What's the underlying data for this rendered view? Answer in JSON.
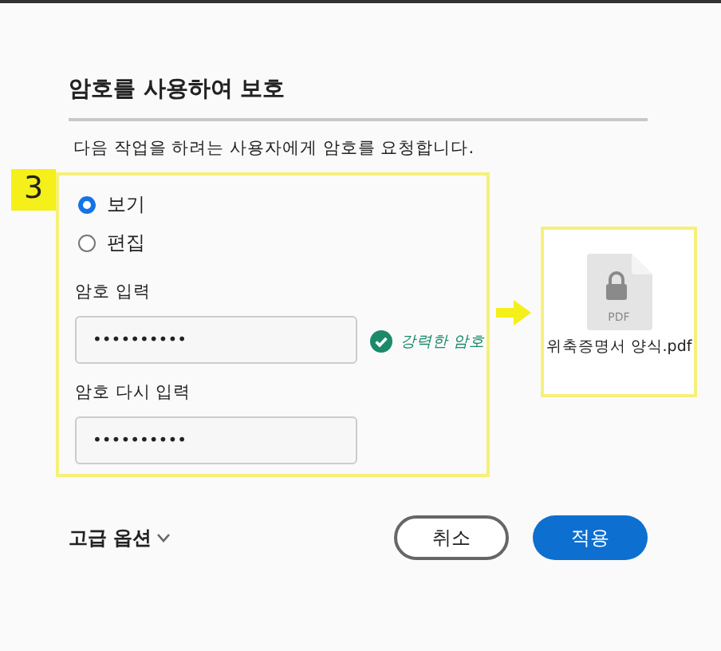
{
  "dialog": {
    "title": "암호를 사용하여 보호",
    "description": "다음 작업을 하려는 사용자에게 암호를 요청합니다."
  },
  "step_badge": "3",
  "permissions": [
    {
      "label": "보기",
      "selected": true
    },
    {
      "label": "편집",
      "selected": false
    }
  ],
  "password": {
    "label": "암호 입력",
    "value": "••••••••••"
  },
  "strength": {
    "text": "강력한 암호",
    "ok": true
  },
  "confirm": {
    "label": "암호 다시 입력",
    "value": "••••••••••"
  },
  "file": {
    "type_label": "PDF",
    "name": "위축증명서 양식.pdf"
  },
  "advanced": {
    "label": "고급 옵션",
    "expanded": false
  },
  "buttons": [
    {
      "label": "취소",
      "kind": "secondary"
    },
    {
      "label": "적용",
      "kind": "primary"
    }
  ]
}
